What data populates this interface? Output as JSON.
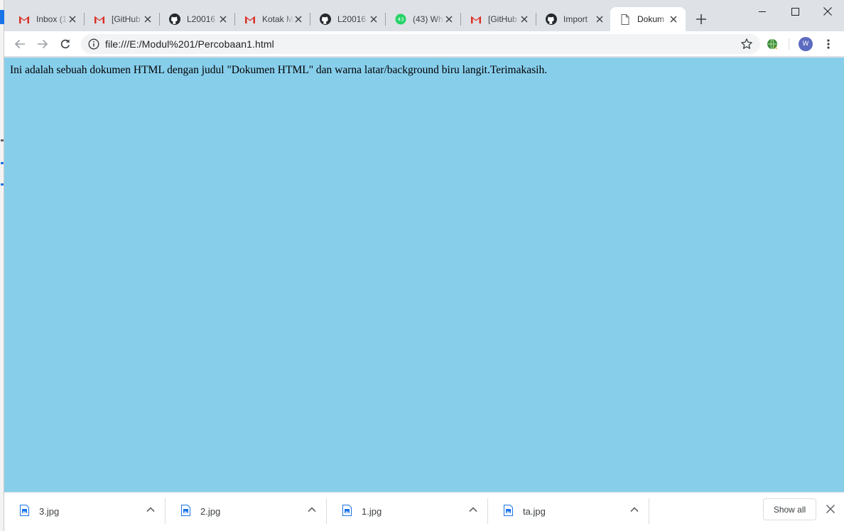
{
  "browser": {
    "tabs": [
      {
        "title": "Inbox (1",
        "icon": "gmail-icon"
      },
      {
        "title": "[GitHub",
        "icon": "gmail-icon"
      },
      {
        "title": "L20016",
        "icon": "github-icon"
      },
      {
        "title": "Kotak M",
        "icon": "gmail-icon"
      },
      {
        "title": "L20016",
        "icon": "github-icon"
      },
      {
        "title": "(43) Wh",
        "icon": "whatsapp-icon",
        "badge": "43"
      },
      {
        "title": "[GitHub",
        "icon": "gmail-icon"
      },
      {
        "title": "Import",
        "icon": "github-icon"
      },
      {
        "title": "Dokum",
        "icon": "document-icon",
        "active": true
      }
    ],
    "address": {
      "url": "file:///E:/Modul%201/Percobaan1.html"
    },
    "profile_initial": "W"
  },
  "page": {
    "text": "Ini adalah sebuah dokumen HTML dengan judul \"Dokumen HTML\" dan warna latar/background biru langit.Terimakasih.",
    "background_color": "#87ceeb"
  },
  "downloads": {
    "items": [
      {
        "name": "3.jpg"
      },
      {
        "name": "2.jpg"
      },
      {
        "name": "1.jpg"
      },
      {
        "name": "ta.jpg"
      }
    ],
    "show_all_label": "Show all"
  },
  "colors": {
    "gmail_red": "#d93025",
    "github_black": "#24292e",
    "whatsapp_green": "#25d366",
    "chrome_tabstrip": "#dee1e6",
    "avatar_bg": "#5c6bc0"
  }
}
